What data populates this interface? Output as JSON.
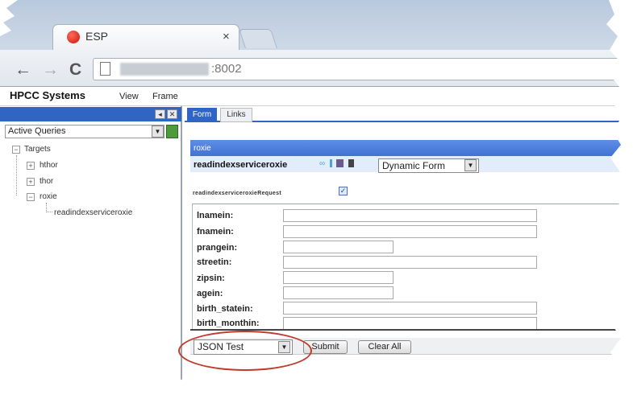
{
  "browser": {
    "tab_title": "ESP",
    "tab_close": "×",
    "url_port": ":8002",
    "nav": {
      "back": "←",
      "forward": "→",
      "reload": "C"
    }
  },
  "app": {
    "brand": "HPCC Systems",
    "menu": [
      "View",
      "Frame"
    ]
  },
  "left_panel": {
    "head_buttons": [
      "◂",
      "✕"
    ],
    "query_select": "Active Queries",
    "tree": {
      "root": "Targets",
      "children": [
        "hthor",
        "thor",
        "roxie"
      ],
      "leaf": "readindexserviceroxie"
    },
    "expand_symbols": {
      "collapsed": "+",
      "expanded": "−"
    }
  },
  "right_panel": {
    "tabs": [
      "Form",
      "Links"
    ],
    "target": "roxie",
    "service_name": "readindexserviceroxie",
    "form_type": "Dynamic Form",
    "request_label": "readindexserviceroxieRequest",
    "request_checked": "✓",
    "fields": [
      {
        "label": "lnamein:"
      },
      {
        "label": "fnamein:"
      },
      {
        "label": "prangein:"
      },
      {
        "label": "streetin:"
      },
      {
        "label": "zipsin:"
      },
      {
        "label": "agein:"
      },
      {
        "label": "birth_statein:"
      },
      {
        "label": "birth_monthin:"
      }
    ],
    "action_select": "JSON Test",
    "submit_label": "Submit",
    "clear_label": "Clear All"
  },
  "colors": {
    "accent_blue": "#2f66c6",
    "annotation_red": "#c0392b"
  }
}
